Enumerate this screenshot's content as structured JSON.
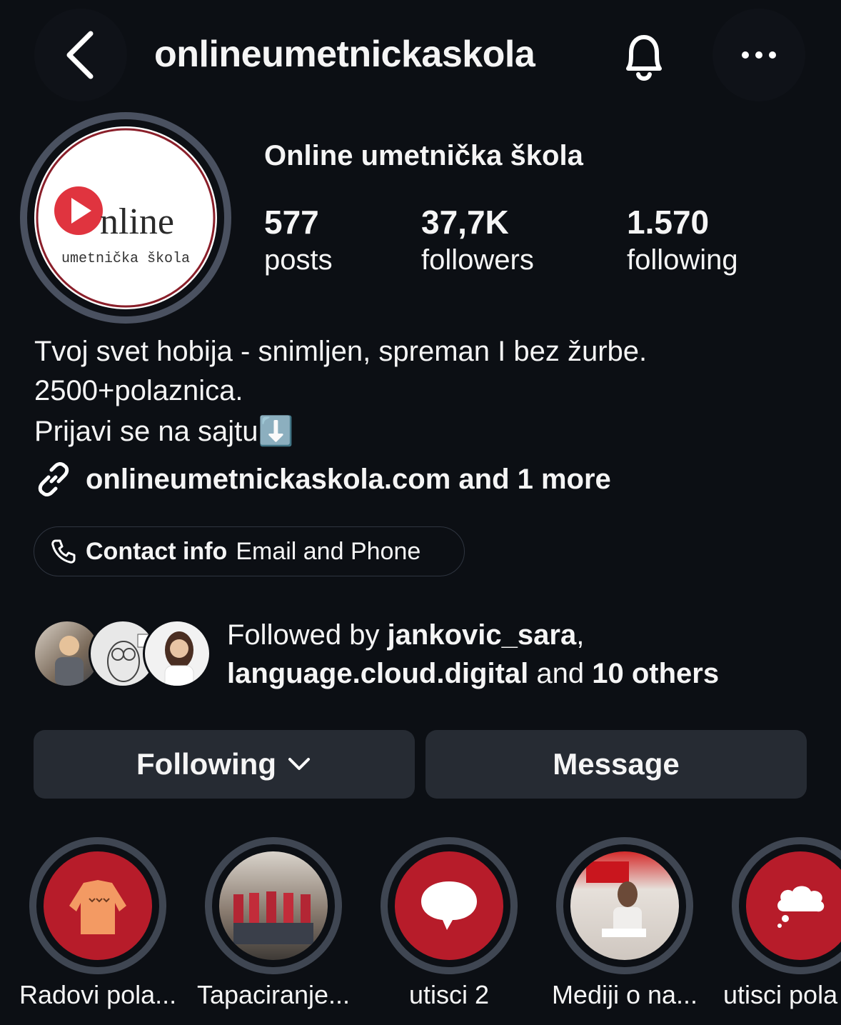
{
  "header": {
    "username": "onlineumetnickaskola",
    "back_icon": "chevron-left-icon",
    "bell_icon": "bell-icon",
    "more_icon": "more-dots-icon"
  },
  "profile": {
    "display_name": "Online umetnička škola",
    "avatar_logo": {
      "line1": "nline",
      "line2": "umetnička škola",
      "accent": "#e0343f"
    },
    "stats": [
      {
        "value": "577",
        "label": "posts"
      },
      {
        "value": "37,7K",
        "label": "followers"
      },
      {
        "value": "1.570",
        "label": "following"
      }
    ],
    "bio": [
      "Tvoj svet hobija - snimljen, spreman I bez žurbe.",
      "2500+polaznica.",
      "Prijavi se na sajtu⬇️"
    ],
    "link_text": "onlineumetnickaskola.com and 1 more",
    "contact": {
      "label": "Contact info",
      "sub": "Email and Phone"
    }
  },
  "followed_by": {
    "prefix": "Followed by ",
    "user1": "jankovic_sara",
    "sep": ",",
    "user2": "language.cloud.digital",
    "mid": " and ",
    "others": "10 others"
  },
  "actions": {
    "following": "Following",
    "message": "Message"
  },
  "highlights": [
    {
      "label": "Radovi pola..."
    },
    {
      "label": "Tapaciranje..."
    },
    {
      "label": "utisci 2"
    },
    {
      "label": "Mediji o na..."
    },
    {
      "label": "utisci pola"
    }
  ],
  "colors": {
    "background": "#0c0f14",
    "button": "#262b33",
    "highlight_red": "#b71c2a"
  }
}
